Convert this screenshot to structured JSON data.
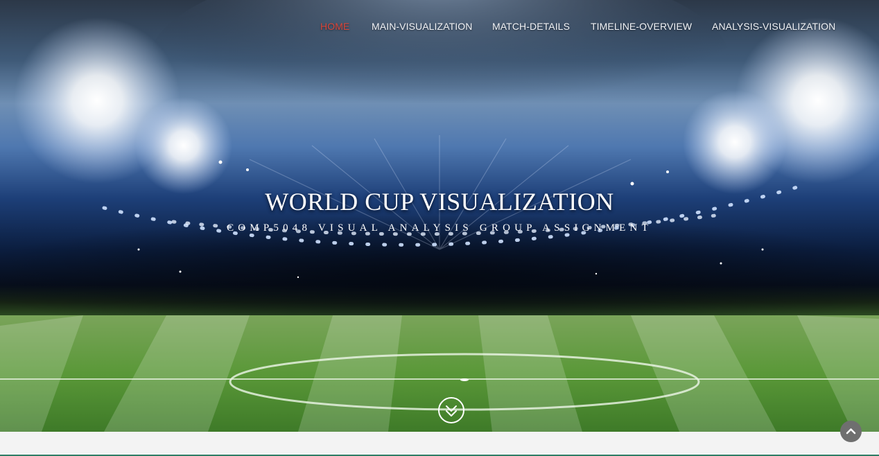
{
  "nav": {
    "items": [
      {
        "label": "HOME",
        "active": true
      },
      {
        "label": "MAIN-VISUALIZATION",
        "active": false
      },
      {
        "label": "MATCH-DETAILS",
        "active": false
      },
      {
        "label": "TIMELINE-OVERVIEW",
        "active": false
      },
      {
        "label": "ANALYSIS-VISUALIZATION",
        "active": false
      }
    ],
    "active_color": "#d9463a"
  },
  "hero": {
    "title": "WORLD CUP VISUALIZATION",
    "subtitle": "COMP5048 VISUAL ANALYSIS GROUP ASSIGNMENT",
    "scroll_icon": "double-chevron-down-icon"
  },
  "back_to_top": {
    "icon": "chevron-up-icon"
  }
}
